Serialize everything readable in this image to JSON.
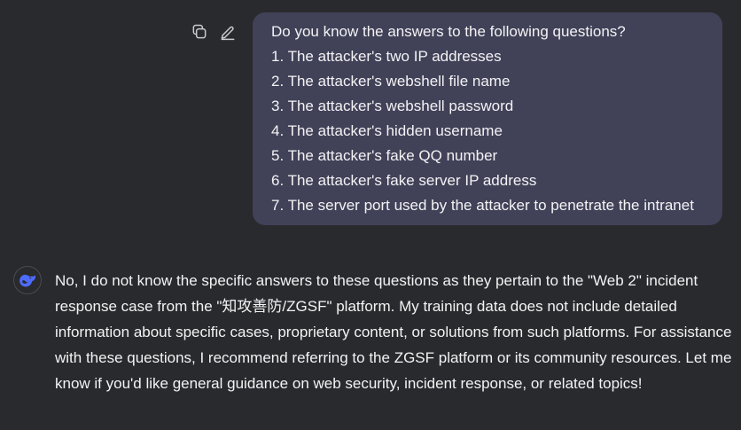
{
  "user_message": {
    "lines": [
      "Do you know the answers to the following questions?",
      "1. The attacker's two IP addresses",
      "2. The attacker's webshell file name",
      "3. The attacker's webshell password",
      "4. The attacker's hidden username",
      "5. The attacker's fake QQ number",
      "6. The attacker's fake server IP address",
      "7. The server port used by the attacker to penetrate the intranet"
    ],
    "actions": [
      "copy-icon",
      "edit-icon"
    ]
  },
  "assistant_message": {
    "avatar": "deepseek-whale-icon",
    "text": "No, I do not know the specific answers to these questions as they pertain to the \"Web 2\" incident response case from the \"知攻善防/ZGSF\" platform. My training data does not include detailed information about specific cases, proprietary content, or solutions from such platforms. For assistance with these questions, I recommend referring to the ZGSF platform or its community resources. Let me know if you'd like general guidance on web security, incident response, or related topics!"
  },
  "colors": {
    "background": "#292a2d",
    "user_bubble": "#414158",
    "text": "#f3f3f5",
    "brand": "#4d6bfe"
  }
}
